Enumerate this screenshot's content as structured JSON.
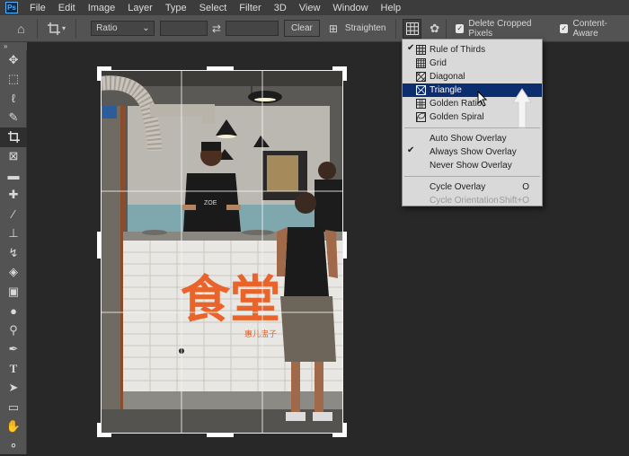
{
  "menubar": {
    "logo": "Ps",
    "items": [
      "File",
      "Edit",
      "Image",
      "Layer",
      "Type",
      "Select",
      "Filter",
      "3D",
      "View",
      "Window",
      "Help"
    ]
  },
  "options": {
    "ratio": "Ratio",
    "clear": "Clear",
    "straighten": "Straighten",
    "delete_cropped": "Delete Cropped Pixels",
    "content_aware": "Content-Aware"
  },
  "overlay_menu": {
    "items": [
      {
        "label": "Rule of Thirds",
        "checked": true,
        "icon": "rule-of-thirds-icon"
      },
      {
        "label": "Grid",
        "checked": false,
        "icon": "grid-icon"
      },
      {
        "label": "Diagonal",
        "checked": false,
        "icon": "diagonal-icon"
      },
      {
        "label": "Triangle",
        "checked": false,
        "icon": "triangle-icon",
        "highlighted": true
      },
      {
        "label": "Golden Ratio",
        "checked": false,
        "icon": "golden-ratio-icon"
      },
      {
        "label": "Golden Spiral",
        "checked": false,
        "icon": "golden-spiral-icon"
      }
    ],
    "show_items": [
      {
        "label": "Auto Show Overlay",
        "checked": false
      },
      {
        "label": "Always Show Overlay",
        "checked": true
      },
      {
        "label": "Never Show Overlay",
        "checked": false
      }
    ],
    "cycle_items": [
      {
        "label": "Cycle Overlay",
        "shortcut": "O",
        "disabled": false
      },
      {
        "label": "Cycle Orientation",
        "shortcut": "Shift+O",
        "disabled": true
      }
    ]
  },
  "photo": {
    "sign_big": "食堂",
    "sign_small": "惠儿盅子"
  },
  "colors": {
    "accent": "#0c2d6e",
    "sign_orange": "#e8642a"
  }
}
